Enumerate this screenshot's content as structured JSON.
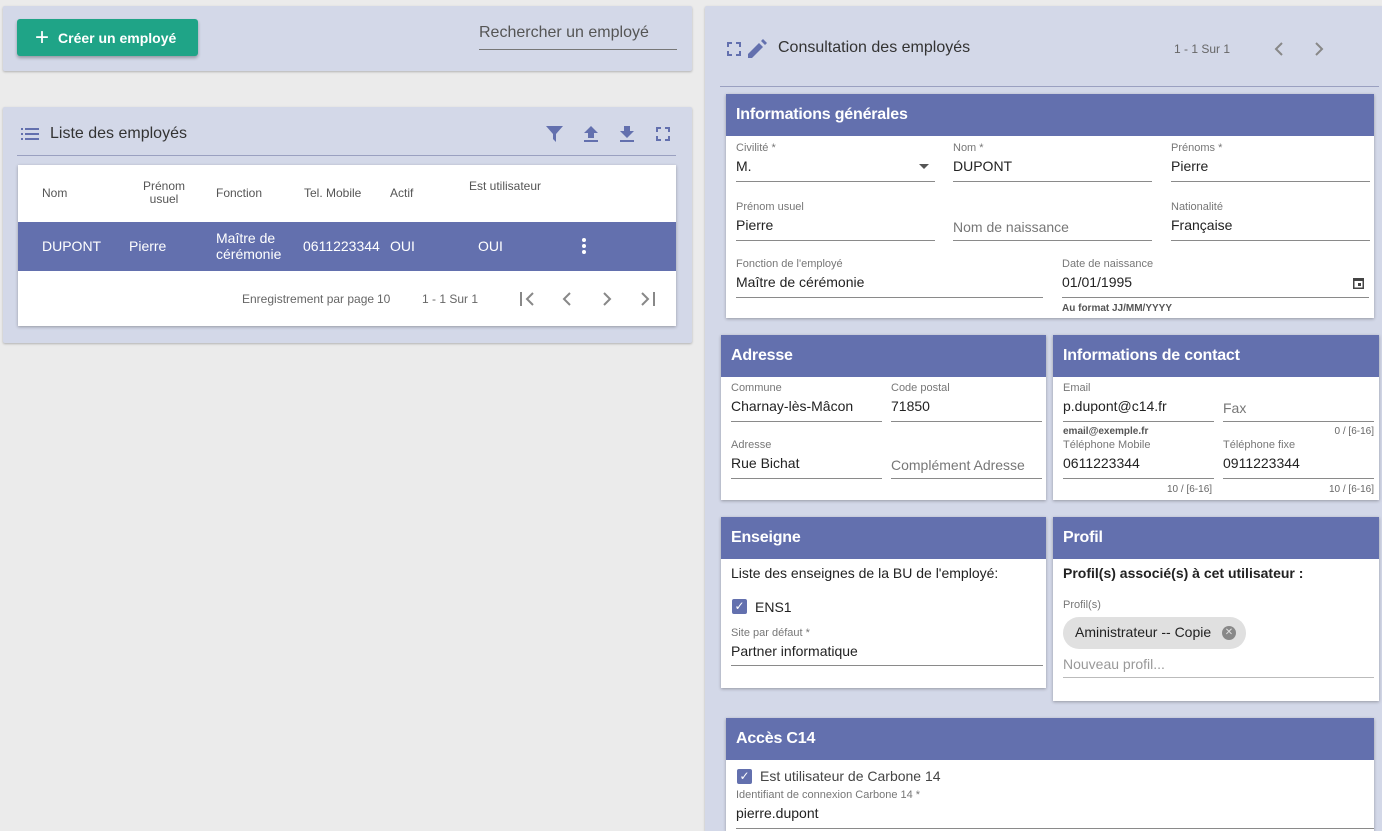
{
  "toolbar": {
    "create_label": "Créer un employé",
    "search_placeholder": "Rechercher un employé"
  },
  "list": {
    "title": "Liste des employés",
    "columns": [
      "Nom",
      "Prénom usuel",
      "Fonction",
      "Tel. Mobile",
      "Actif",
      "Est utilisateur"
    ],
    "rows": [
      {
        "nom": "DUPONT",
        "prenom": "Pierre",
        "fonction": "Maître de cérémonie",
        "mobile": "0611223344",
        "actif": "OUI",
        "utilisateur": "OUI"
      }
    ],
    "pagination": {
      "per_page_label": "Enregistrement par page",
      "per_page": "10",
      "range": "1 - 1 Sur 1"
    }
  },
  "detail": {
    "title": "Consultation des employés",
    "range": "1 - 1 Sur 1",
    "general": {
      "title": "Informations générales",
      "civilite_label": "Civilité *",
      "civilite": "M.",
      "nom_label": "Nom *",
      "nom": "DUPONT",
      "prenoms_label": "Prénoms *",
      "prenoms": "Pierre",
      "prenom_usuel_label": "Prénom usuel",
      "prenom_usuel": "Pierre",
      "nom_naissance_placeholder": "Nom de naissance",
      "nationalite_label": "Nationalité",
      "nationalite": "Française",
      "fonction_label": "Fonction de l'employé",
      "fonction": "Maître de cérémonie",
      "date_label": "Date de naissance",
      "date": "01/01/1995",
      "date_hint": "Au format JJ/MM/YYYY"
    },
    "adresse": {
      "title": "Adresse",
      "commune_label": "Commune",
      "commune": "Charnay-lès-Mâcon",
      "cp_label": "Code postal",
      "cp": "71850",
      "adresse_label": "Adresse",
      "adresse": "Rue Bichat",
      "complement_placeholder": "Complément Adresse"
    },
    "contact": {
      "title": "Informations de contact",
      "email_label": "Email",
      "email": "p.dupont@c14.fr",
      "email_hint": "email@exemple.fr",
      "fax_placeholder": "Fax",
      "fax_counter": "0 / [6-16]",
      "mobile_label": "Téléphone Mobile",
      "mobile": "0611223344",
      "mobile_counter": "10 / [6-16]",
      "fixe_label": "Téléphone fixe",
      "fixe": "0911223344",
      "fixe_counter": "10 / [6-16]"
    },
    "enseigne": {
      "title": "Enseigne",
      "subtitle": "Liste des enseignes de la BU de l'employé:",
      "item": "ENS1",
      "site_label": "Site par défaut *",
      "site": "Partner informatique"
    },
    "profil": {
      "title": "Profil",
      "subtitle": "Profil(s) associé(s) à cet utilisateur :",
      "profils_label": "Profil(s)",
      "chip": "Aministrateur -- Copie",
      "new_placeholder": "Nouveau profil..."
    },
    "acces": {
      "title": "Accès C14",
      "checkbox_label": "Est utilisateur de Carbone 14",
      "login_label": "Identifiant de connexion Carbone 14 *",
      "login": "pierre.dupont"
    }
  }
}
